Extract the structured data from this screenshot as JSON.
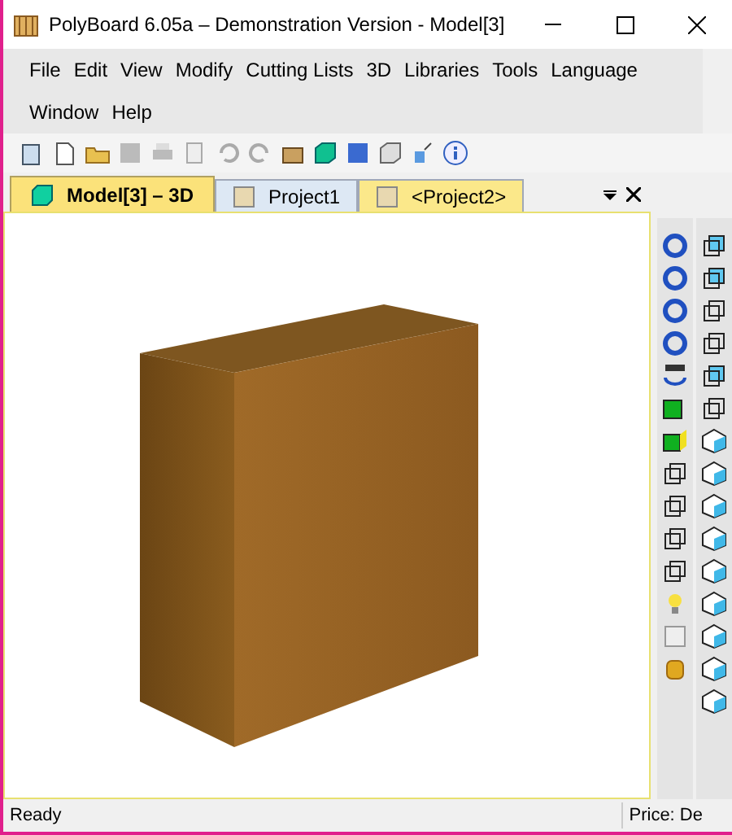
{
  "window": {
    "title": "PolyBoard 6.05a – Demonstration Version - Model[3]"
  },
  "menu": [
    "File",
    "Edit",
    "View",
    "Modify",
    "Cutting Lists",
    "3D",
    "Libraries",
    "Tools",
    "Language",
    "Window",
    "Help"
  ],
  "tabs": [
    {
      "label": "Model[3] – 3D",
      "selected": true,
      "kind": "model"
    },
    {
      "label": "Project1",
      "selected": false,
      "kind": "project"
    },
    {
      "label": "<Project2>",
      "selected": false,
      "kind": "project"
    }
  ],
  "status_bar": {
    "message": "Ready",
    "price": "Price: De"
  }
}
